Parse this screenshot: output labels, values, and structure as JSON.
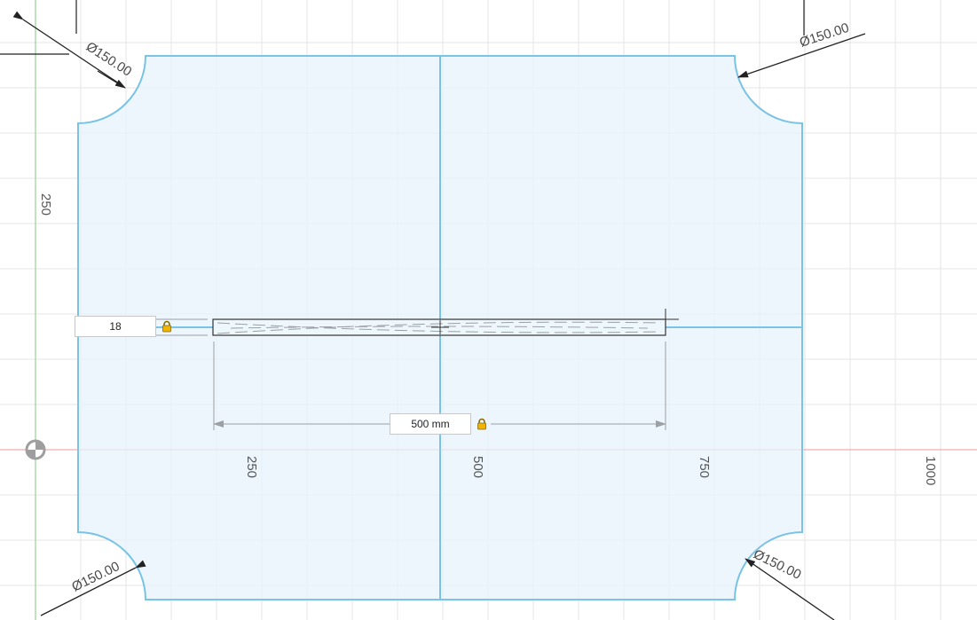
{
  "viewport": {
    "grid_labels": {
      "x_ticks": [
        "250",
        "500",
        "750",
        "1000"
      ],
      "y_ticks": [
        "250"
      ]
    }
  },
  "sketch": {
    "corner_dimensions": [
      {
        "position": "top-left",
        "label": "Ø150.00"
      },
      {
        "position": "top-right",
        "label": "Ø150.00"
      },
      {
        "position": "bottom-left",
        "label": "Ø150.00"
      },
      {
        "position": "bottom-right",
        "label": "Ø150.00"
      }
    ],
    "thickness_input": {
      "value": "18"
    },
    "length_input": {
      "value": "500 mm"
    }
  },
  "icons": {
    "lock": "lock-icon",
    "origin": "origin-icon"
  },
  "colors": {
    "profile_fill": "#e6f3fb",
    "profile_stroke": "#79c3e6",
    "x_axis": "#ef9a9a",
    "y_axis": "#81c784",
    "grid": "#e6e6e6",
    "dimension": "#333333",
    "lock": "#f0b400"
  }
}
